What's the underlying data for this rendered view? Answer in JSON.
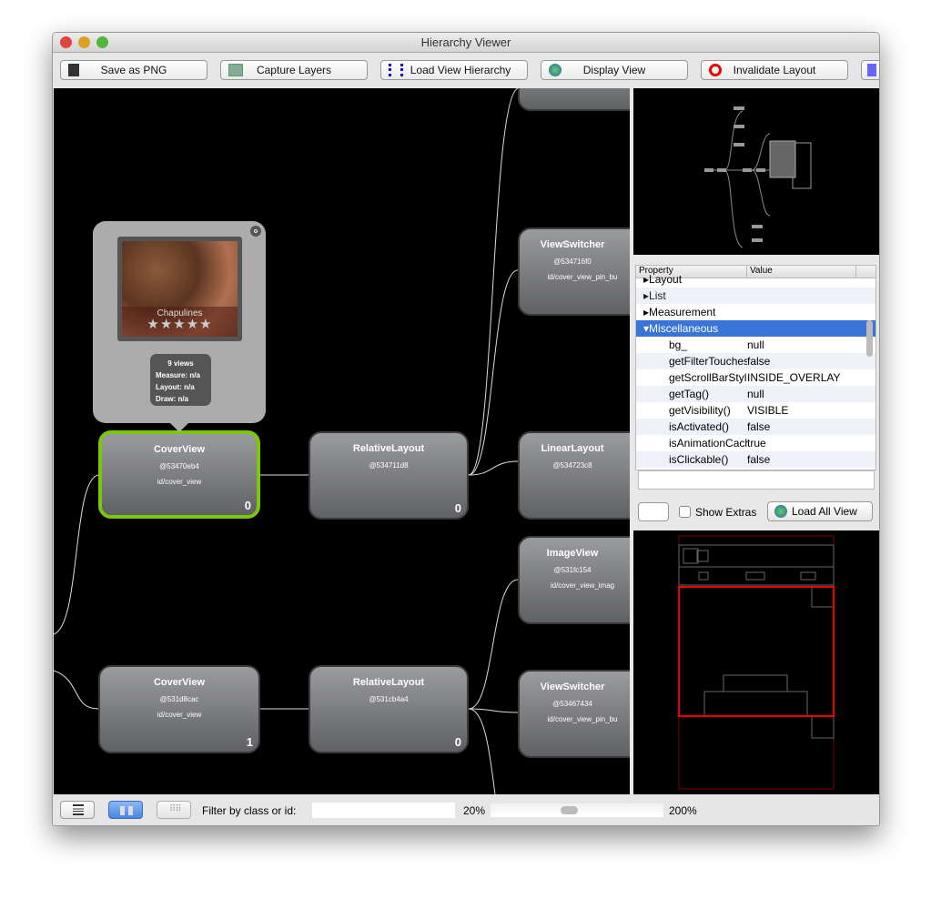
{
  "window": {
    "title": "Hierarchy Viewer"
  },
  "toolbar": {
    "buttons": [
      {
        "label": "Save as PNG",
        "icon": "floppy-disk-icon"
      },
      {
        "label": "Capture Layers",
        "icon": "layers-icon"
      },
      {
        "label": "Load View Hierarchy",
        "icon": "hierarchy-icon"
      },
      {
        "label": "Display View",
        "icon": "globe-icon"
      },
      {
        "label": "Invalidate Layout",
        "icon": "no-entry-icon"
      }
    ]
  },
  "popup": {
    "image_caption": "Chapulines",
    "rating_stars": 5,
    "views": "9 views",
    "measure": "Measure: n/a",
    "layout": "Layout: n/a",
    "draw": "Draw: n/a"
  },
  "nodes": [
    {
      "name": "CoverView",
      "hash": "@53470eb4",
      "id": "id/cover_view",
      "index": "0",
      "selected": true
    },
    {
      "name": "RelativeLayout",
      "hash": "@534711d8",
      "id": "",
      "index": "0"
    },
    {
      "name": "ViewSwitcher",
      "hash": "@534716f0",
      "id": "id/cover_view_pin_bu",
      "index": ""
    },
    {
      "name": "LinearLayout",
      "hash": "@534723c8",
      "id": "",
      "index": ""
    },
    {
      "name": "ImageView",
      "hash": "@531fc154",
      "id": "id/cover_view_imag",
      "index": ""
    },
    {
      "name": "ViewSwitcher",
      "hash": "@53467434",
      "id": "id/cover_view_pin_bu",
      "index": ""
    },
    {
      "name": "CoverView",
      "hash": "@531d8cac",
      "id": "id/cover_view",
      "index": "1"
    },
    {
      "name": "RelativeLayout",
      "hash": "@531cb4a4",
      "id": "",
      "index": "0"
    }
  ],
  "properties": {
    "col_property": "Property",
    "col_value": "Value",
    "groups": [
      "Layout",
      "List",
      "Measurement",
      "Miscellaneous"
    ],
    "rows": [
      {
        "k": "bg_",
        "v": "null"
      },
      {
        "k": "getFilterTouchesWhenObscured()",
        "v": "false"
      },
      {
        "k": "getScrollBarStyle()",
        "v": "INSIDE_OVERLAY"
      },
      {
        "k": "getTag()",
        "v": "null"
      },
      {
        "k": "getVisibility()",
        "v": "VISIBLE"
      },
      {
        "k": "isActivated()",
        "v": "false"
      },
      {
        "k": "isAnimationCacheEnabled()",
        "v": "true"
      },
      {
        "k": "isClickable()",
        "v": "false"
      }
    ]
  },
  "controls": {
    "show_extras": "Show Extras",
    "load_all": "Load All View"
  },
  "bottom": {
    "filter_label": "Filter by class or id:",
    "filter_value": "",
    "zoom_min": "20%",
    "zoom_max": "200%",
    "zoom_level_fraction": 0.45
  }
}
